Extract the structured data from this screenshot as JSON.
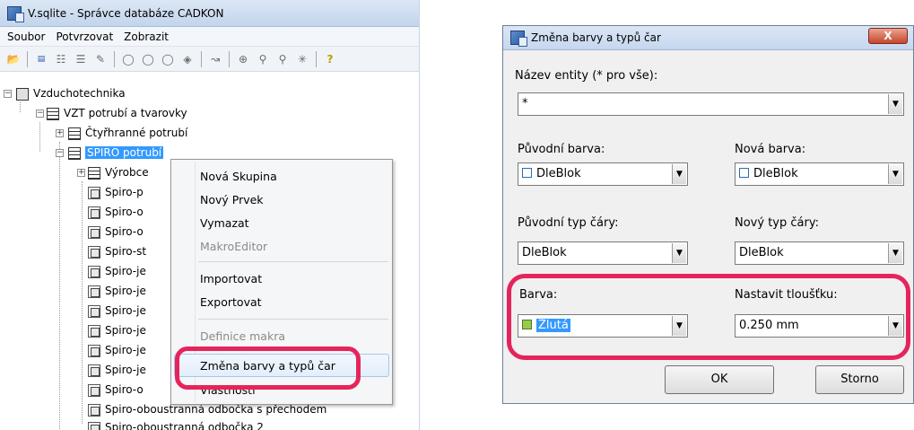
{
  "left_window": {
    "title": "V.sqlite - Správce databáze CADKON",
    "menu": [
      "Soubor",
      "Potvrzovat",
      "Zobrazit"
    ],
    "tree": {
      "root": "Vzduchotechnika",
      "child": "VZT potrubí a tvarovky",
      "items": [
        "Čtyřhranné potrubí",
        "SPIRO potrubí",
        "Výrobce",
        "Spiro-p",
        "Spiro-o",
        "Spiro-o",
        "Spiro-st",
        "Spiro-je",
        "Spiro-je",
        "Spiro-je",
        "Spiro-je",
        "Spiro-je",
        "Spiro-je",
        "Spiro-o",
        "Spiro-oboustranná odbočka s přechodem",
        "Spiro-oboustranná odbočka 2"
      ]
    },
    "context_menu": {
      "items": [
        {
          "label": "Nová Skupina",
          "enabled": true
        },
        {
          "label": "Nový Prvek",
          "enabled": true
        },
        {
          "label": "Vymazat",
          "enabled": true
        },
        {
          "label": "MakroEditor",
          "enabled": false
        },
        {
          "label": "Importovat",
          "enabled": true
        },
        {
          "label": "Exportovat",
          "enabled": true
        },
        {
          "label": "Definice makra",
          "enabled": false
        },
        {
          "label": "Změna barvy a typů čar",
          "enabled": true
        },
        {
          "label": "Vlastnosti",
          "enabled": true
        }
      ]
    }
  },
  "dialog": {
    "title": "Změna barvy a typů čar",
    "close_label": "X",
    "entity_label": "Název entity (* pro vše):",
    "entity_value": "*",
    "orig_color_label": "Původní barva:",
    "orig_color_value": "DleBlok",
    "new_color_label": "Nová barva:",
    "new_color_value": "DleBlok",
    "orig_linetype_label": "Původní typ čáry:",
    "orig_linetype_value": "DleBlok",
    "new_linetype_label": "Nový typ čáry:",
    "new_linetype_value": "DleBlok",
    "color_label": "Barva:",
    "color_value": "Žlutá",
    "thickness_label": "Nastavit tloušťku:",
    "thickness_value": "0.250 mm",
    "ok_label": "OK",
    "cancel_label": "Storno"
  },
  "colors": {
    "annotation": "#e5245c",
    "selection": "#3399ff"
  }
}
